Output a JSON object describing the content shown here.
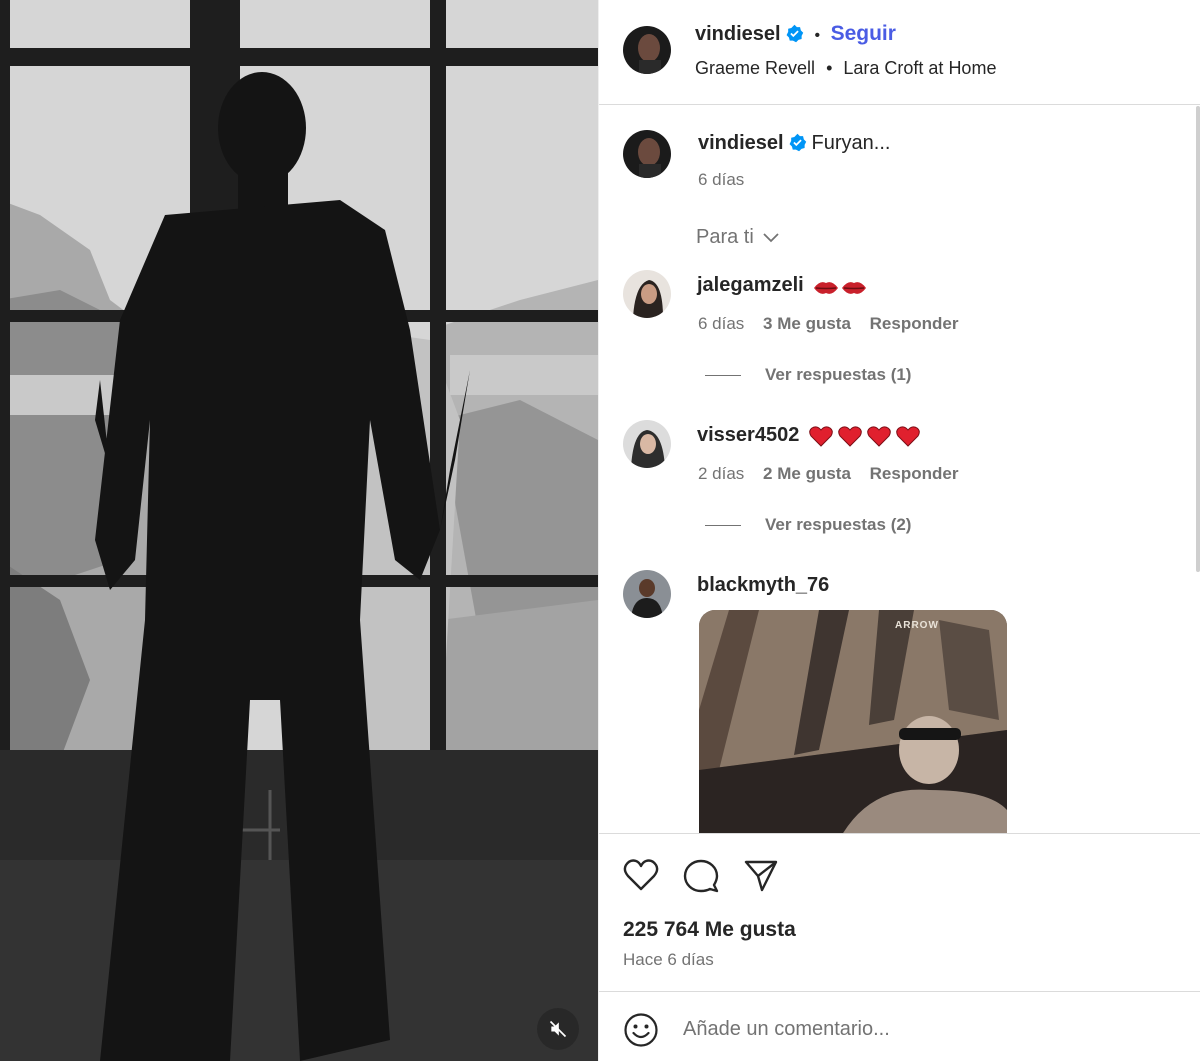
{
  "post": {
    "author": "vindiesel",
    "follow_label": "Seguir",
    "separator": "•",
    "audio_artist": "Graeme Revell",
    "audio_title": "Lara Croft at Home",
    "caption_author": "vindiesel",
    "caption_text": "Furyan...",
    "caption_age": "6 días"
  },
  "sort": {
    "label": "Para ti"
  },
  "comments": [
    {
      "user": "jalegamzeli",
      "text": "",
      "age": "6 días",
      "likes": "3 Me gusta",
      "reply_label": "Responder",
      "view_replies": "Ver respuestas (1)"
    },
    {
      "user": "visser4502",
      "text": "",
      "age": "2 días",
      "likes": "2 Me gusta",
      "reply_label": "Responder",
      "view_replies": "Ver respuestas (2)"
    },
    {
      "user": "blackmyth_76",
      "gif_overlay_text": "ARROW"
    }
  ],
  "footer": {
    "likes_count": "225 764 Me gusta",
    "posted": "Hace 6 días",
    "comment_placeholder": "Añade un comentario..."
  },
  "colors": {
    "accent": "#4a5ce4",
    "verified": "#0095f6",
    "text": "#262626",
    "secondary": "#737373"
  },
  "icons": [
    "verified-badge-icon",
    "chevron-down-icon",
    "heart-icon",
    "comment-icon",
    "share-icon",
    "emoji-icon",
    "muted-speaker-icon"
  ]
}
